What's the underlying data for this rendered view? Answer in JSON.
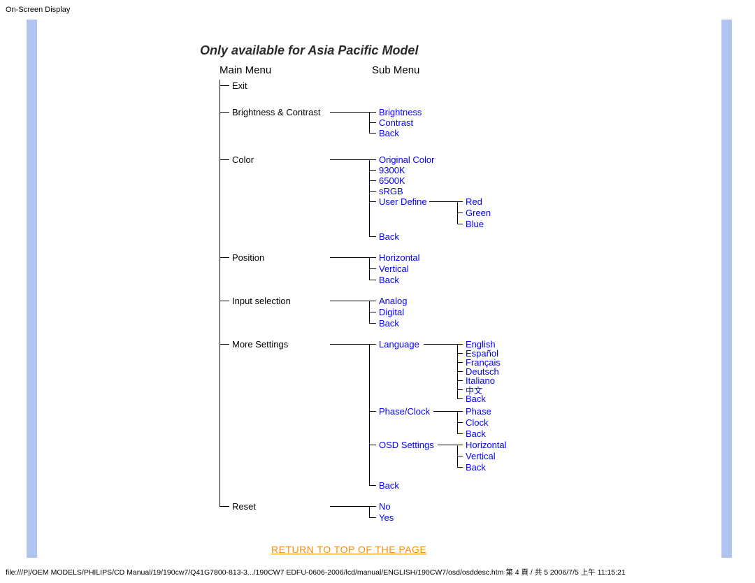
{
  "header": {
    "title": "On-Screen Display"
  },
  "heading": "Only available for Asia Pacific Model",
  "columns": {
    "main": "Main Menu",
    "sub": "Sub Menu"
  },
  "main_menu": {
    "exit": "Exit",
    "brightness_contrast": "Brightness & Contrast",
    "color": "Color",
    "position": "Position",
    "input_selection": "Input selection",
    "more_settings": "More Settings",
    "reset": "Reset"
  },
  "sub": {
    "brightness": "Brightness",
    "contrast": "Contrast",
    "back": "Back",
    "original_color": "Original Color",
    "k9300": "9300K",
    "k6500": "6500K",
    "srgb": "sRGB",
    "user_define": "User Define",
    "horizontal": "Horizontal",
    "vertical": "Vertical",
    "analog": "Analog",
    "digital": "Digital",
    "language": "Language",
    "phase_clock": "Phase/Clock",
    "osd_settings": "OSD Settings",
    "no": "No",
    "yes": "Yes"
  },
  "third": {
    "red": "Red",
    "green": "Green",
    "blue": "Blue",
    "english": "English",
    "espanol": "Español",
    "francais": "Français",
    "deutsch": "Deutsch",
    "italiano": "Italiano",
    "chinese": "中文",
    "back": "Back",
    "phase": "Phase",
    "clock": "Clock",
    "horizontal": "Horizontal",
    "vertical": "Vertical"
  },
  "return_link": "RETURN TO TOP OF THE PAGE",
  "footer": "file:///P|/OEM MODELS/PHILIPS/CD Manual/19/190cw7/Q41G7800-813-3.../190CW7 EDFU-0606-2006/lcd/manual/ENGLISH/190CW7/osd/osddesc.htm 第 4 頁 / 共 5 2006/7/5 上午 11:15:21"
}
